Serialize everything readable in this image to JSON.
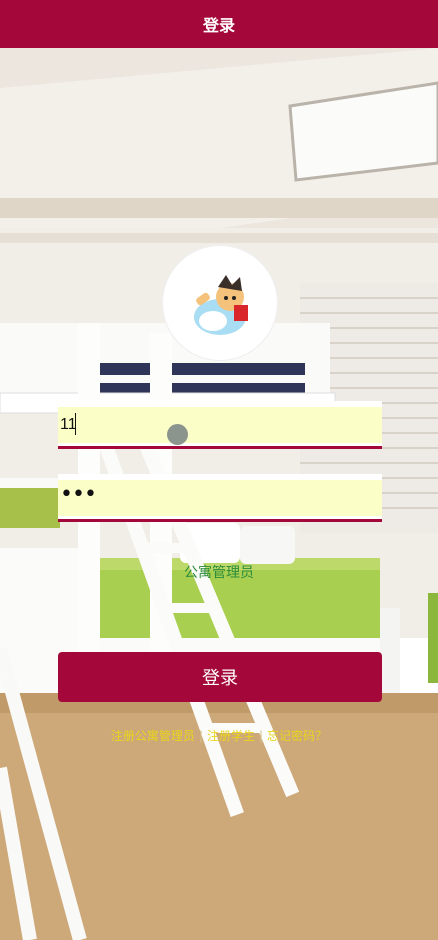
{
  "header": {
    "title": "登录"
  },
  "login_form": {
    "username_value": "11",
    "password_mask": "•••",
    "role_label": "公寓管理员",
    "submit_label": "登录"
  },
  "footer_links": [
    {
      "label": "注册公寓管理员"
    },
    {
      "label": "注册学生"
    },
    {
      "label": "忘记密码？"
    }
  ],
  "colors": {
    "brand": "#a4083b",
    "input_bg": "#fbfec6",
    "role_text": "#2b8c3a",
    "link_text": "#e9d51c"
  }
}
